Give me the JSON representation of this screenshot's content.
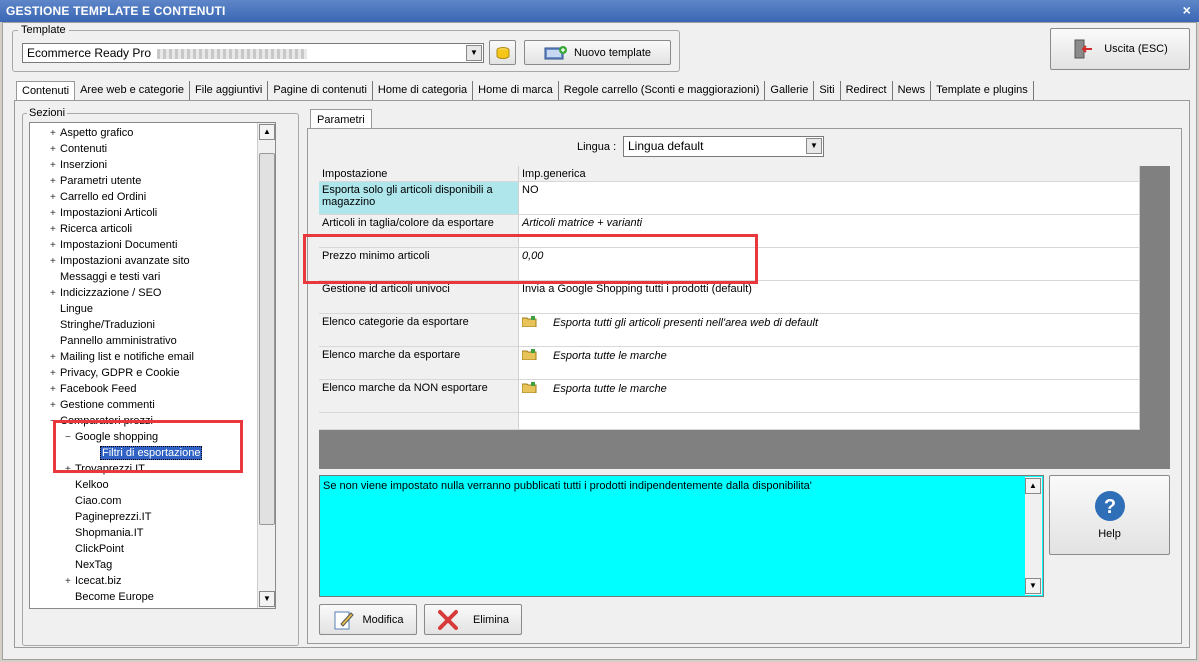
{
  "window": {
    "title": "GESTIONE TEMPLATE E CONTENUTI",
    "close": "×"
  },
  "template": {
    "group_label": "Template",
    "selected": "Ecommerce Ready Pro",
    "new_button": "Nuovo template",
    "exit_button": "Uscita (ESC)"
  },
  "tabs": [
    "Contenuti",
    "Aree web e categorie",
    "File aggiuntivi",
    "Pagine di contenuti",
    "Home di categoria",
    "Home di marca",
    "Regole carrello (Sconti e maggiorazioni)",
    "Gallerie",
    "Siti",
    "Redirect",
    "News",
    "Template e plugins"
  ],
  "sezioni": {
    "label": "Sezioni",
    "items": [
      {
        "label": "Aspetto grafico",
        "exp": "+",
        "level": 0
      },
      {
        "label": "Contenuti",
        "exp": "+",
        "level": 0
      },
      {
        "label": "Inserzioni",
        "exp": "+",
        "level": 0
      },
      {
        "label": "Parametri utente",
        "exp": "+",
        "level": 0
      },
      {
        "label": "Carrello ed Ordini",
        "exp": "+",
        "level": 0
      },
      {
        "label": "Impostazioni Articoli",
        "exp": "+",
        "level": 0
      },
      {
        "label": "Ricerca articoli",
        "exp": "+",
        "level": 0
      },
      {
        "label": "Impostazioni Documenti",
        "exp": "+",
        "level": 0
      },
      {
        "label": "Impostazioni avanzate sito",
        "exp": "+",
        "level": 0
      },
      {
        "label": "Messaggi e testi vari",
        "exp": "",
        "level": 0
      },
      {
        "label": "Indicizzazione / SEO",
        "exp": "+",
        "level": 0
      },
      {
        "label": "Lingue",
        "exp": "",
        "level": 0
      },
      {
        "label": "Stringhe/Traduzioni",
        "exp": "",
        "level": 0
      },
      {
        "label": "Pannello amministrativo",
        "exp": "",
        "level": 0
      },
      {
        "label": "Mailing list e notifiche email",
        "exp": "+",
        "level": 0
      },
      {
        "label": "Privacy, GDPR e Cookie",
        "exp": "+",
        "level": 0
      },
      {
        "label": "Facebook Feed",
        "exp": "+",
        "level": 0
      },
      {
        "label": "Gestione commenti",
        "exp": "+",
        "level": 0
      },
      {
        "label": "Comparatori prezzi",
        "exp": "−",
        "level": 0
      },
      {
        "label": "Google shopping",
        "exp": "−",
        "level": 1
      },
      {
        "label": "Filtri di esportazione",
        "exp": "",
        "level": 2,
        "selected": true
      },
      {
        "label": "Trovaprezzi.IT",
        "exp": "+",
        "level": 1
      },
      {
        "label": "Kelkoo",
        "exp": "",
        "level": 1
      },
      {
        "label": "Ciao.com",
        "exp": "",
        "level": 1
      },
      {
        "label": "Pagineprezzi.IT",
        "exp": "",
        "level": 1
      },
      {
        "label": "Shopmania.IT",
        "exp": "",
        "level": 1
      },
      {
        "label": "ClickPoint",
        "exp": "",
        "level": 1
      },
      {
        "label": "NexTag",
        "exp": "",
        "level": 1
      },
      {
        "label": "Icecat.biz",
        "exp": "+",
        "level": 1
      },
      {
        "label": "Become Europe",
        "exp": "",
        "level": 1
      }
    ]
  },
  "parametri": {
    "tab_label": "Parametri",
    "lingua_label": "Lingua :",
    "lingua_value": "Lingua default",
    "columns": [
      "Impostazione",
      "Imp.generica"
    ],
    "rows": [
      {
        "setting": "Esporta solo gli articoli disponibili a magazzino",
        "value": "NO",
        "italic": false,
        "folder": false,
        "highlight": true
      },
      {
        "setting": "Articoli in taglia/colore da esportare",
        "value": "Articoli matrice + varianti",
        "italic": true,
        "folder": false
      },
      {
        "setting": "Prezzo minimo articoli",
        "value": "0,00",
        "italic": true,
        "folder": false
      },
      {
        "setting": "Gestione id articoli univoci",
        "value": "Invia a Google Shopping tutti i prodotti (default)",
        "italic": false,
        "folder": false
      },
      {
        "setting": "Elenco categorie da esportare",
        "value": "Esporta tutti gli articoli presenti nell'area web di default",
        "italic": true,
        "folder": true
      },
      {
        "setting": "Elenco marche da esportare",
        "value": "Esporta tutte le marche",
        "italic": true,
        "folder": true
      },
      {
        "setting": "Elenco marche da NON esportare",
        "value": "Esporta tutte le marche",
        "italic": true,
        "folder": true
      }
    ],
    "description": "Se non viene impostato nulla verranno pubblicati tutti i prodotti indipendentemente dalla disponibilita'",
    "help_button": "Help",
    "help_glyph": "?",
    "edit_button": "Modifica",
    "delete_button": "Elimina"
  },
  "colors": {
    "highlight_red": "#e8383d",
    "description_bg": "#00ffff",
    "selected_row_bg": "#aee6ec"
  }
}
